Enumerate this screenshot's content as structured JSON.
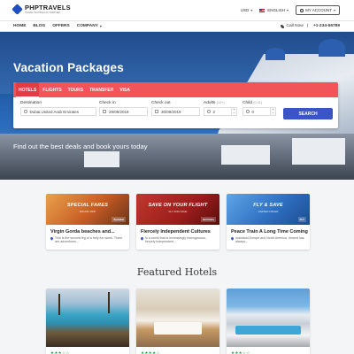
{
  "header": {
    "brand_name": "PHPTRAVELS",
    "brand_tagline": "TRAVEL TECHNOLOGY PARTNER",
    "currency": "USD",
    "language": "ENGLISH",
    "account_label": "MY ACCOUNT"
  },
  "nav": {
    "items": [
      {
        "label": "HOME"
      },
      {
        "label": "BLOG"
      },
      {
        "label": "OFFERS"
      },
      {
        "label": "COMPANY"
      }
    ],
    "call_label": "Call Now",
    "phone": "+1-234-56789"
  },
  "hero": {
    "title": "Vacation Packages",
    "subtitle": "Find out the best deals and book yours today"
  },
  "search": {
    "tabs": [
      {
        "label": "HOTELS",
        "active": true
      },
      {
        "label": "FLIGHTS"
      },
      {
        "label": "TOURS"
      },
      {
        "label": "TRANSFER"
      },
      {
        "label": "VISA"
      }
    ],
    "destination_label": "Destination",
    "destination_value": "Dubai,United Arab Emirates",
    "checkin_label": "Check in",
    "checkin_value": "29/09/2019",
    "checkout_label": "Check out",
    "checkout_value": "30/09/2019",
    "adults_label": "Adults",
    "adults_hint": "(12+)",
    "adults_value": "2",
    "child_label": "Child",
    "child_hint": "(0-11)",
    "child_value": "0",
    "search_button": "SEARCH"
  },
  "deals": [
    {
      "banner_title": "SPECIAL FARES",
      "banner_sub": "ROUND TRIP",
      "banner_brand": "flydubai",
      "title": "Virgin Gorda beaches and...",
      "desc": "This is the second leg of a truly fun week. There are adventures..."
    },
    {
      "banner_title": "SAVE ON YOUR FLIGHT",
      "banner_sub": "FLY AND SAVE",
      "banner_brand": "Emirates",
      "title": "Fiercely Independent Cultures",
      "desc": "In a world that is increasingly homogenous, fiercely independent..."
    },
    {
      "banner_title": "FLY & SAVE",
      "banner_sub": "LIMITED OFFER",
      "banner_brand": "FLY",
      "title": "Peace Train A Long Time Coming",
      "desc": "mainland Europe and North America. Ireland has always..."
    }
  ],
  "featured": {
    "title": "Featured Hotels",
    "hotels": [
      {
        "stars": "★★★☆☆"
      },
      {
        "stars": "★★★★☆"
      },
      {
        "stars": "★★★☆☆"
      }
    ]
  },
  "colors": {
    "accent": "#f2545b",
    "primary_button": "#3a55c8",
    "star": "#2f9a46"
  }
}
